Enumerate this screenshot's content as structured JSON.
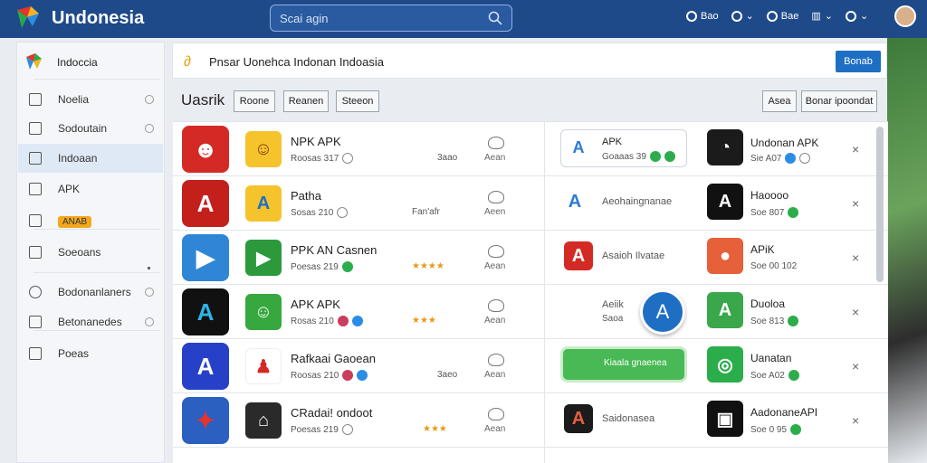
{
  "header": {
    "brand": "Undonesia",
    "search_placeholder": "Scai agin",
    "actions": [
      "Bao",
      "",
      "Bae",
      "",
      ""
    ]
  },
  "sidebar": {
    "title": "Indoccia",
    "items": [
      {
        "label": "Noelia"
      },
      {
        "label": "Sodoutain"
      },
      {
        "label": "Indoaan"
      },
      {
        "label": "APK"
      },
      {
        "label": "ANAB"
      },
      {
        "label": "Soeoans"
      },
      {
        "label": "Bodonanlaners"
      },
      {
        "label": "Betonanedes"
      },
      {
        "label": "Poeas"
      }
    ]
  },
  "banner": {
    "text": "Pnsar Uonehca Indonan Indoasia",
    "button": "Bonab"
  },
  "filters": {
    "title": "Uasrik",
    "chips": [
      "Roone",
      "Reanen",
      "Steeon"
    ],
    "right_chips": [
      "Asea",
      "Bonar ipoondat"
    ]
  },
  "rows": [
    {
      "name": "NPK APK",
      "meta": "Roosas 317",
      "mid": "3aao",
      "mid_lbl": "Aean",
      "r_name": "APK",
      "r_meta": "Goaaas 39",
      "rr_name": "Undonan APK",
      "rr_meta": "Sie A07"
    },
    {
      "name": "Patha",
      "meta": "Sosas 210",
      "mid": "Fan'afr",
      "mid_lbl": "Aeen",
      "r_name": "Aeohaingnanae",
      "r_meta": "",
      "rr_name": "Haoooo",
      "rr_meta": "Soe 807"
    },
    {
      "name": "PPK AN Casnen",
      "meta": "Poesas 219",
      "mid": "",
      "mid_lbl": "Aean",
      "r_name": "Asaioh Ilvatae",
      "r_meta": "",
      "rr_name": "APiK",
      "rr_meta": "Soe 00 102"
    },
    {
      "name": "APK APK",
      "meta": "Rosas 210",
      "mid": "",
      "mid_lbl": "Aean",
      "r_name": "Aeiik",
      "r_meta": "Saoa",
      "rr_name": "Duoloa",
      "rr_meta": "Soe 813"
    },
    {
      "name": "Rafkaai Gaoean",
      "meta": "Roosas 210",
      "mid": "3aeo",
      "mid_lbl": "Aean",
      "r_name": "Kiaala gnaenea",
      "r_meta": "",
      "rr_name": "Uanatan",
      "rr_meta": "Soe A02"
    },
    {
      "name": "CRadai! ondoot",
      "meta": "Poesas 219",
      "mid": "",
      "mid_lbl": "Aean",
      "r_name": "Saidonasea",
      "r_meta": "",
      "rr_name": "AadonaneAPI",
      "rr_meta": "Soe 0 95"
    }
  ],
  "colors": {
    "topbar": "#1f4a8a",
    "accent": "#1e6fc4",
    "badge": "#f2a81d"
  }
}
